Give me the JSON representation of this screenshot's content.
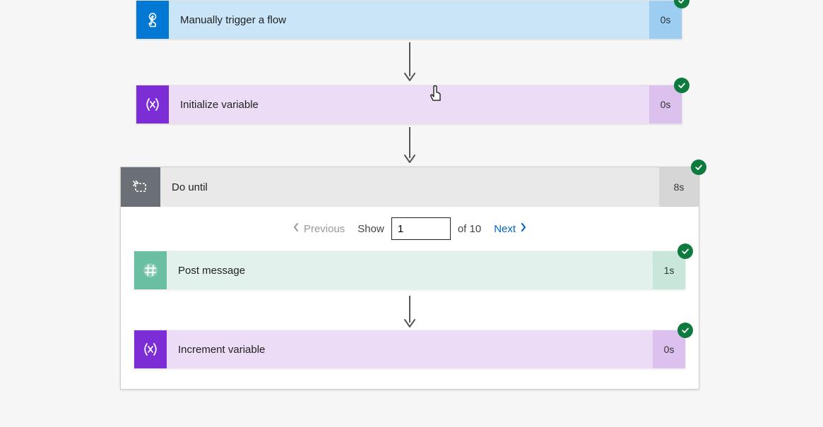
{
  "steps": {
    "trigger": {
      "label": "Manually trigger a flow",
      "duration": "0s"
    },
    "initVar": {
      "label": "Initialize variable",
      "duration": "0s"
    },
    "doUntil": {
      "label": "Do until",
      "duration": "8s"
    },
    "postMsg": {
      "label": "Post message",
      "duration": "1s"
    },
    "incrVar": {
      "label": "Increment variable",
      "duration": "0s"
    }
  },
  "pager": {
    "previous": "Previous",
    "show": "Show",
    "currentValue": "1",
    "ofTotal": "of 10",
    "next": "Next"
  }
}
